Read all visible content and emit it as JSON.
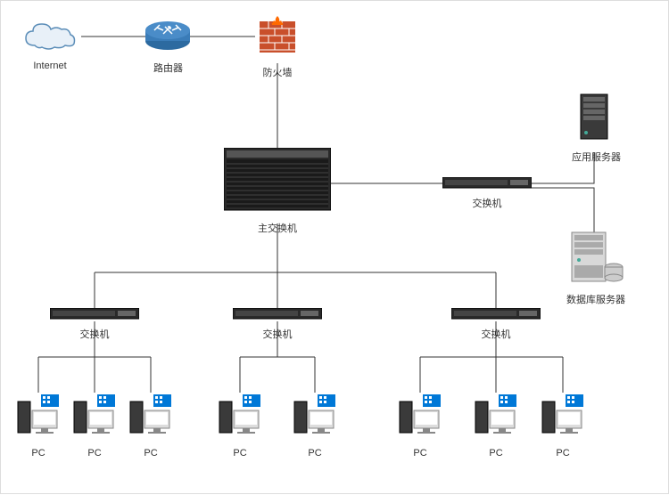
{
  "nodes": {
    "internet": {
      "label": "Internet",
      "type": "cloud"
    },
    "router": {
      "label": "路由器",
      "type": "router"
    },
    "firewall": {
      "label": "防火墙",
      "type": "firewall"
    },
    "mainSwitch": {
      "label": "主交换机",
      "type": "main-switch"
    },
    "switchRight": {
      "label": "交换机",
      "type": "switch"
    },
    "appServer": {
      "label": "应用服务器",
      "type": "server"
    },
    "dbServer": {
      "label": "数据库服务器",
      "type": "db-server"
    },
    "switchA": {
      "label": "交换机",
      "type": "switch"
    },
    "switchB": {
      "label": "交换机",
      "type": "switch"
    },
    "switchC": {
      "label": "交换机",
      "type": "switch"
    },
    "pc1": {
      "label": "PC",
      "type": "pc"
    },
    "pc2": {
      "label": "PC",
      "type": "pc"
    },
    "pc3": {
      "label": "PC",
      "type": "pc"
    },
    "pc4": {
      "label": "PC",
      "type": "pc"
    },
    "pc5": {
      "label": "PC",
      "type": "pc"
    },
    "pc6": {
      "label": "PC",
      "type": "pc"
    },
    "pc7": {
      "label": "PC",
      "type": "pc"
    },
    "pc8": {
      "label": "PC",
      "type": "pc"
    }
  },
  "connections": [
    [
      "internet",
      "router"
    ],
    [
      "router",
      "firewall"
    ],
    [
      "firewall",
      "mainSwitch"
    ],
    [
      "mainSwitch",
      "switchRight"
    ],
    [
      "switchRight",
      "appServer"
    ],
    [
      "switchRight",
      "dbServer"
    ],
    [
      "mainSwitch",
      "switchA"
    ],
    [
      "mainSwitch",
      "switchB"
    ],
    [
      "mainSwitch",
      "switchC"
    ],
    [
      "switchA",
      "pc1"
    ],
    [
      "switchA",
      "pc2"
    ],
    [
      "switchA",
      "pc3"
    ],
    [
      "switchB",
      "pc4"
    ],
    [
      "switchB",
      "pc5"
    ],
    [
      "switchC",
      "pc6"
    ],
    [
      "switchC",
      "pc7"
    ],
    [
      "switchC",
      "pc8"
    ]
  ]
}
